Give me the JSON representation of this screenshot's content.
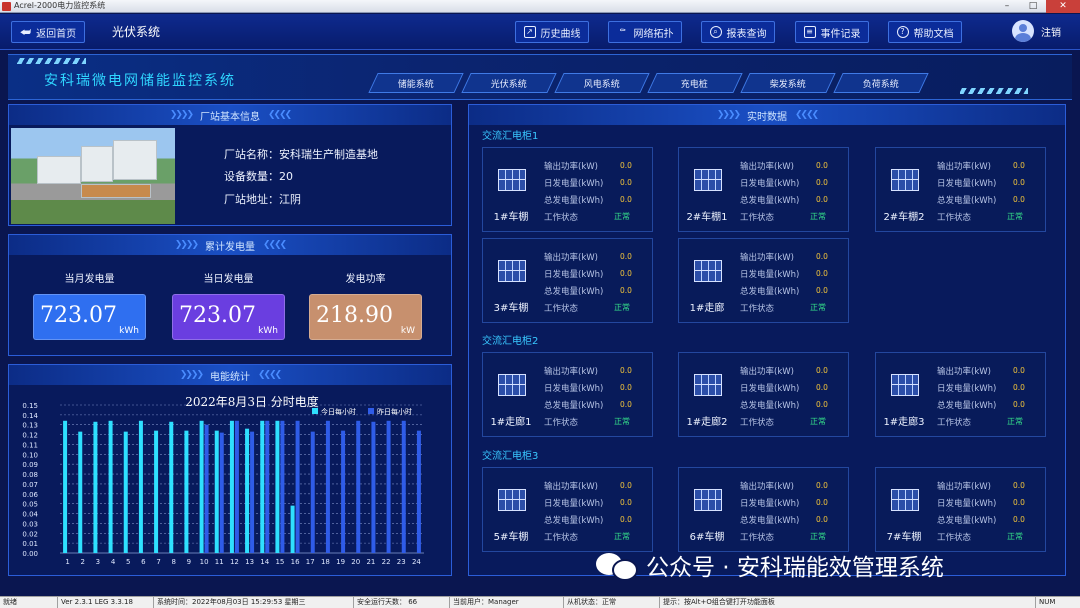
{
  "window": {
    "title": "Acrel-2000电力监控系统"
  },
  "topbar": {
    "back_label": "返回首页",
    "page_title": "光伏系统",
    "buttons": [
      "历史曲线",
      "网络拓扑",
      "报表查询",
      "事件记录",
      "帮助文档"
    ],
    "logout_label": "注销"
  },
  "banner": {
    "system_title": "安科瑞微电网储能监控系统",
    "nav": [
      "储能系统",
      "光伏系统",
      "风电系统",
      "充电桩",
      "柴发系统",
      "负荷系统"
    ]
  },
  "station": {
    "panel_title": "厂站基本信息",
    "name_row": "厂站名称：安科瑞生产制造基地",
    "count_row": "设备数量：20",
    "address_row": "厂站地址：江阴"
  },
  "accumulative": {
    "panel_title": "累计发电量",
    "items": [
      {
        "label": "当月发电量",
        "value": "723.07",
        "unit": "kWh",
        "color": "#2f6ff0"
      },
      {
        "label": "当日发电量",
        "value": "723.07",
        "unit": "kWh",
        "color": "#6a3ee0"
      },
      {
        "label": "发电功率",
        "value": "218.90",
        "unit": "kW",
        "color": "#c7906e"
      }
    ]
  },
  "energy_stats": {
    "panel_title": "电能统计"
  },
  "chart_data": {
    "type": "bar",
    "title": "2022年8月3日   分时电度",
    "categories": [
      "1",
      "2",
      "3",
      "4",
      "5",
      "6",
      "7",
      "8",
      "9",
      "10",
      "11",
      "12",
      "13",
      "14",
      "15",
      "16",
      "17",
      "18",
      "19",
      "20",
      "21",
      "22",
      "23",
      "24"
    ],
    "ylim": [
      0,
      0.15
    ],
    "yticks": [
      "0.00",
      "0.01",
      "0.02",
      "0.03",
      "0.04",
      "0.05",
      "0.06",
      "0.07",
      "0.08",
      "0.09",
      "0.10",
      "0.11",
      "0.12",
      "0.13",
      "0.14",
      "0.15"
    ],
    "grid": true,
    "legend_position": "top-right",
    "series": [
      {
        "name": "今日每小时",
        "color": "#2fe0ff",
        "values": [
          0.134,
          0.123,
          0.133,
          0.134,
          0.123,
          0.134,
          0.124,
          0.133,
          0.124,
          0.134,
          0.124,
          0.134,
          0.126,
          0.134,
          0.134,
          0.048,
          null,
          null,
          null,
          null,
          null,
          null,
          null,
          null
        ]
      },
      {
        "name": "昨日每小时",
        "color": "#2f5ce8",
        "values": [
          null,
          null,
          null,
          null,
          null,
          null,
          null,
          null,
          null,
          0.13,
          0.122,
          0.134,
          0.123,
          0.134,
          0.134,
          0.134,
          0.123,
          0.134,
          0.124,
          0.134,
          0.133,
          0.134,
          0.134,
          0.124
        ]
      }
    ]
  },
  "realtime": {
    "panel_title": "实时数据",
    "field_labels": [
      "输出功率(kW)",
      "日发电量(kWh)",
      "总发电量(kWh)",
      "工作状态"
    ],
    "groups": [
      {
        "title": "交流汇电柜1",
        "cards": [
          {
            "name": "1#车棚",
            "p": "0.0",
            "d": "0.0",
            "t": "0.0",
            "s": "正常"
          },
          {
            "name": "2#车棚1",
            "p": "0.0",
            "d": "0.0",
            "t": "0.0",
            "s": "正常"
          },
          {
            "name": "2#车棚2",
            "p": "0.0",
            "d": "0.0",
            "t": "0.0",
            "s": "正常"
          },
          {
            "name": "3#车棚",
            "p": "0.0",
            "d": "0.0",
            "t": "0.0",
            "s": "正常"
          },
          {
            "name": "1#走廊",
            "p": "0.0",
            "d": "0.0",
            "t": "0.0",
            "s": "正常"
          }
        ]
      },
      {
        "title": "交流汇电柜2",
        "cards": [
          {
            "name": "1#走廊1",
            "p": "0.0",
            "d": "0.0",
            "t": "0.0",
            "s": "正常"
          },
          {
            "name": "1#走廊2",
            "p": "0.0",
            "d": "0.0",
            "t": "0.0",
            "s": "正常"
          },
          {
            "name": "1#走廊3",
            "p": "0.0",
            "d": "0.0",
            "t": "0.0",
            "s": "正常"
          }
        ]
      },
      {
        "title": "交流汇电柜3",
        "cards": [
          {
            "name": "5#车棚",
            "p": "0.0",
            "d": "0.0",
            "t": "0.0",
            "s": "正常"
          },
          {
            "name": "6#车棚",
            "p": "0.0",
            "d": "0.0",
            "t": "0.0",
            "s": "正常"
          },
          {
            "name": "7#车棚",
            "p": "0.0",
            "d": "0.0",
            "t": "0.0",
            "s": "正常"
          }
        ]
      }
    ]
  },
  "watermark": {
    "text": "公众号 · 安科瑞能效管理系统"
  },
  "statusbar": {
    "cells": [
      "就绪",
      "Ver 2.3.1 LEG 3.3.18",
      "系统时间：2022年08月03日  15:29:53  星期三",
      "安全运行天数：  66",
      "当前用户：Manager",
      "从机状态：正常",
      "提示：按Alt+O组合键打开功能面板",
      "NUM"
    ]
  }
}
